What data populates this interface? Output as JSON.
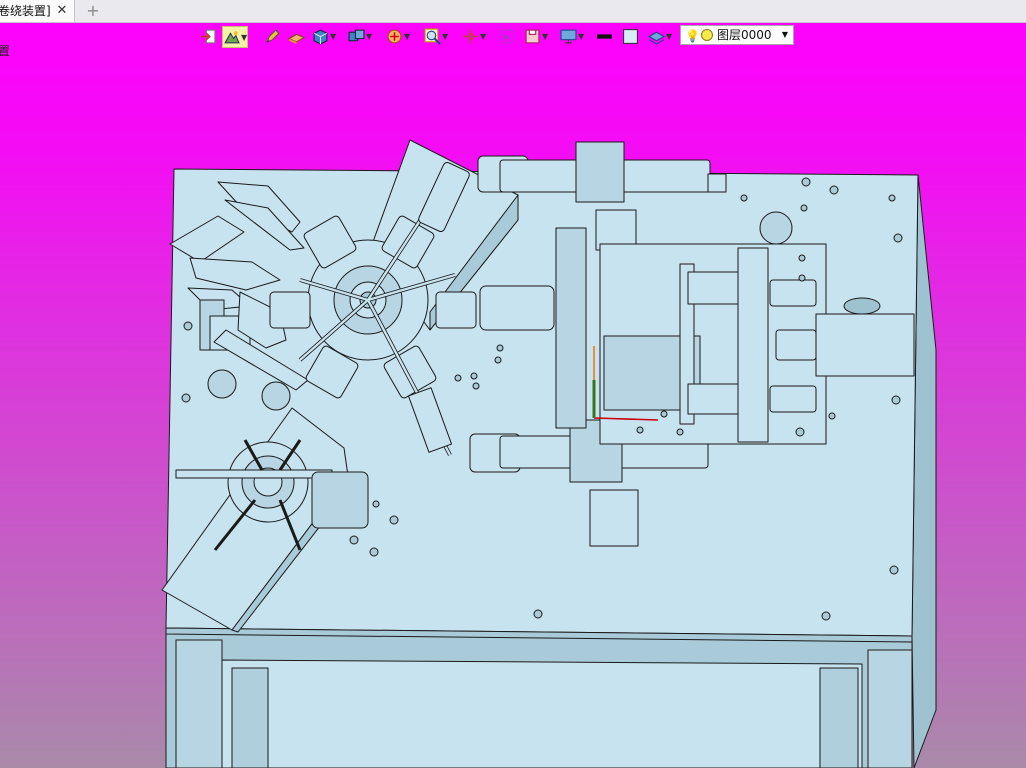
{
  "tabs": [
    {
      "title": "卷绕装置]",
      "close_icon": "close-icon"
    }
  ],
  "tab_add_label": "+",
  "side_label": "置",
  "toolbar": {
    "items": [
      "exit-sketch-icon",
      "view-style-icon",
      "pen-icon",
      "surface-icon",
      "solid-box-icon",
      "assembly-icon",
      "render-icon",
      "zoom-icon",
      "snap-icon",
      "select-icon",
      "save-view-icon",
      "display-monitor-icon",
      "line-style-icon",
      "fill-color-icon",
      "layer-stack-icon"
    ],
    "layer": {
      "name": "图层0000",
      "bulb_icon": "lightbulb-icon",
      "state_icon": "layer-on-icon"
    }
  },
  "colors": {
    "bg_top": "#ff00ff",
    "bg_bottom": "#a98aa9",
    "part_fill": "#c7e3ef",
    "part_shade": "#a9cad8",
    "edge": "#1a1a1a",
    "toolbar_active": "#f2f2a8"
  },
  "model": {
    "description_icon": "cad-machine-model"
  }
}
